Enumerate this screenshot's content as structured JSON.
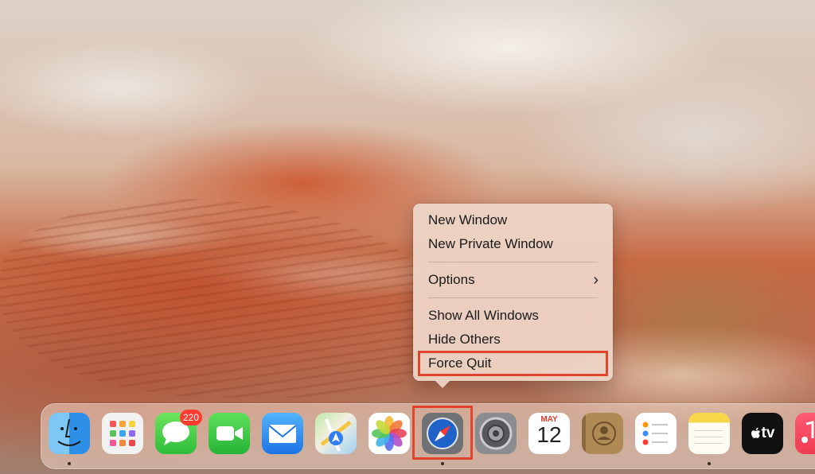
{
  "context_menu": {
    "items": [
      {
        "label": "New Window"
      },
      {
        "label": "New Private Window"
      },
      {
        "label": "Options"
      },
      {
        "label": "Show All Windows"
      },
      {
        "label": "Hide Others"
      },
      {
        "label": "Force Quit"
      }
    ],
    "highlighted_item": "Force Quit"
  },
  "dock": {
    "apps": [
      {
        "name": "finder-icon",
        "running": true
      },
      {
        "name": "launchpad-icon",
        "running": false
      },
      {
        "name": "messages-icon",
        "running": false,
        "badge": "220"
      },
      {
        "name": "facetime-icon",
        "running": false
      },
      {
        "name": "mail-icon",
        "running": false
      },
      {
        "name": "maps-icon",
        "running": false
      },
      {
        "name": "photos-icon",
        "running": false
      },
      {
        "name": "safari-icon",
        "running": true,
        "highlighted": true
      },
      {
        "name": "system-preferences-icon",
        "running": false
      },
      {
        "name": "calendar-icon",
        "running": false
      },
      {
        "name": "contacts-icon",
        "running": false
      },
      {
        "name": "reminders-icon",
        "running": false
      },
      {
        "name": "notes-icon",
        "running": true
      },
      {
        "name": "apple-tv-icon",
        "running": false
      },
      {
        "name": "music-icon",
        "running": false
      }
    ],
    "calendar": {
      "month": "MAY",
      "day": "12"
    },
    "appletv_label": "tv"
  },
  "colors": {
    "highlight": "#e2432b",
    "badge": "#ff3b30"
  }
}
